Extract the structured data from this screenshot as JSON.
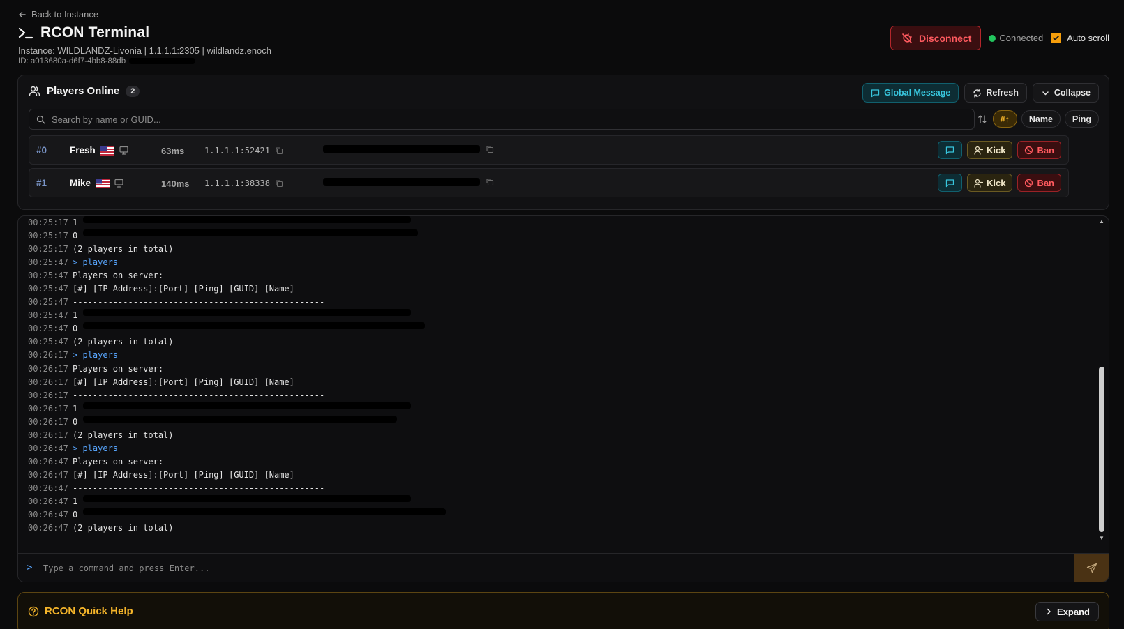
{
  "header": {
    "back_label": "Back to Instance",
    "title": "RCON Terminal",
    "instance_line": "Instance: WILDLANDZ-Livonia | 1.1.1.1:2305 | wildlandz.enoch",
    "id_prefix": "ID: a013680a-d6f7-4bb8-88db",
    "disconnect_label": "Disconnect",
    "status_label": "Connected",
    "autoscroll_label": "Auto scroll",
    "autoscroll_checked": true
  },
  "players_panel": {
    "title": "Players Online",
    "count": "2",
    "global_message_label": "Global Message",
    "refresh_label": "Refresh",
    "collapse_label": "Collapse",
    "search_placeholder": "Search by name or GUID...",
    "sort_options": [
      "#↑",
      "Name",
      "Ping"
    ],
    "active_sort": "#↑",
    "kick_label": "Kick",
    "ban_label": "Ban",
    "players": [
      {
        "index": "#0",
        "name": "Fresh",
        "ping": "63ms",
        "address": "1.1.1.1:52421"
      },
      {
        "index": "#1",
        "name": "Mike",
        "ping": "140ms",
        "address": "1.1.1.1:38338"
      }
    ]
  },
  "console": {
    "lines": [
      {
        "ts": "00:25:17",
        "text": "1",
        "redacted": true
      },
      {
        "ts": "00:25:17",
        "text": "0",
        "redacted": true
      },
      {
        "ts": "00:25:17",
        "text": "(2 players in total)"
      },
      {
        "ts": "00:25:47",
        "text": "> players",
        "cmd": true
      },
      {
        "ts": "00:25:47",
        "text": "Players on server:"
      },
      {
        "ts": "00:25:47",
        "text": "[#] [IP Address]:[Port] [Ping] [GUID] [Name]"
      },
      {
        "ts": "00:25:47",
        "text": "--------------------------------------------------"
      },
      {
        "ts": "00:25:47",
        "text": "1",
        "redacted": true
      },
      {
        "ts": "00:25:47",
        "text": "0",
        "redacted": true
      },
      {
        "ts": "00:25:47",
        "text": "(2 players in total)"
      },
      {
        "ts": "00:26:17",
        "text": "> players",
        "cmd": true
      },
      {
        "ts": "00:26:17",
        "text": "Players on server:"
      },
      {
        "ts": "00:26:17",
        "text": "[#] [IP Address]:[Port] [Ping] [GUID] [Name]"
      },
      {
        "ts": "00:26:17",
        "text": "--------------------------------------------------"
      },
      {
        "ts": "00:26:17",
        "text": "1",
        "redacted": true
      },
      {
        "ts": "00:26:17",
        "text": "0",
        "redacted": true
      },
      {
        "ts": "00:26:17",
        "text": "(2 players in total)"
      },
      {
        "ts": "00:26:47",
        "text": "> players",
        "cmd": true
      },
      {
        "ts": "00:26:47",
        "text": "Players on server:"
      },
      {
        "ts": "00:26:47",
        "text": "[#] [IP Address]:[Port] [Ping] [GUID] [Name]"
      },
      {
        "ts": "00:26:47",
        "text": "--------------------------------------------------"
      },
      {
        "ts": "00:26:47",
        "text": "1",
        "redacted": true
      },
      {
        "ts": "00:26:47",
        "text": "0",
        "redacted": true
      },
      {
        "ts": "00:26:47",
        "text": "(2 players in total)"
      }
    ],
    "input_placeholder": "Type a command and press Enter...",
    "prompt": ">"
  },
  "quick_help": {
    "title": "RCON Quick Help",
    "expand_label": "Expand"
  },
  "colors": {
    "accent": "#f59e0b",
    "danger": "#ff5a5f",
    "success": "#22c55e",
    "cyan": "#38c6dd",
    "command": "#58a6ff"
  }
}
